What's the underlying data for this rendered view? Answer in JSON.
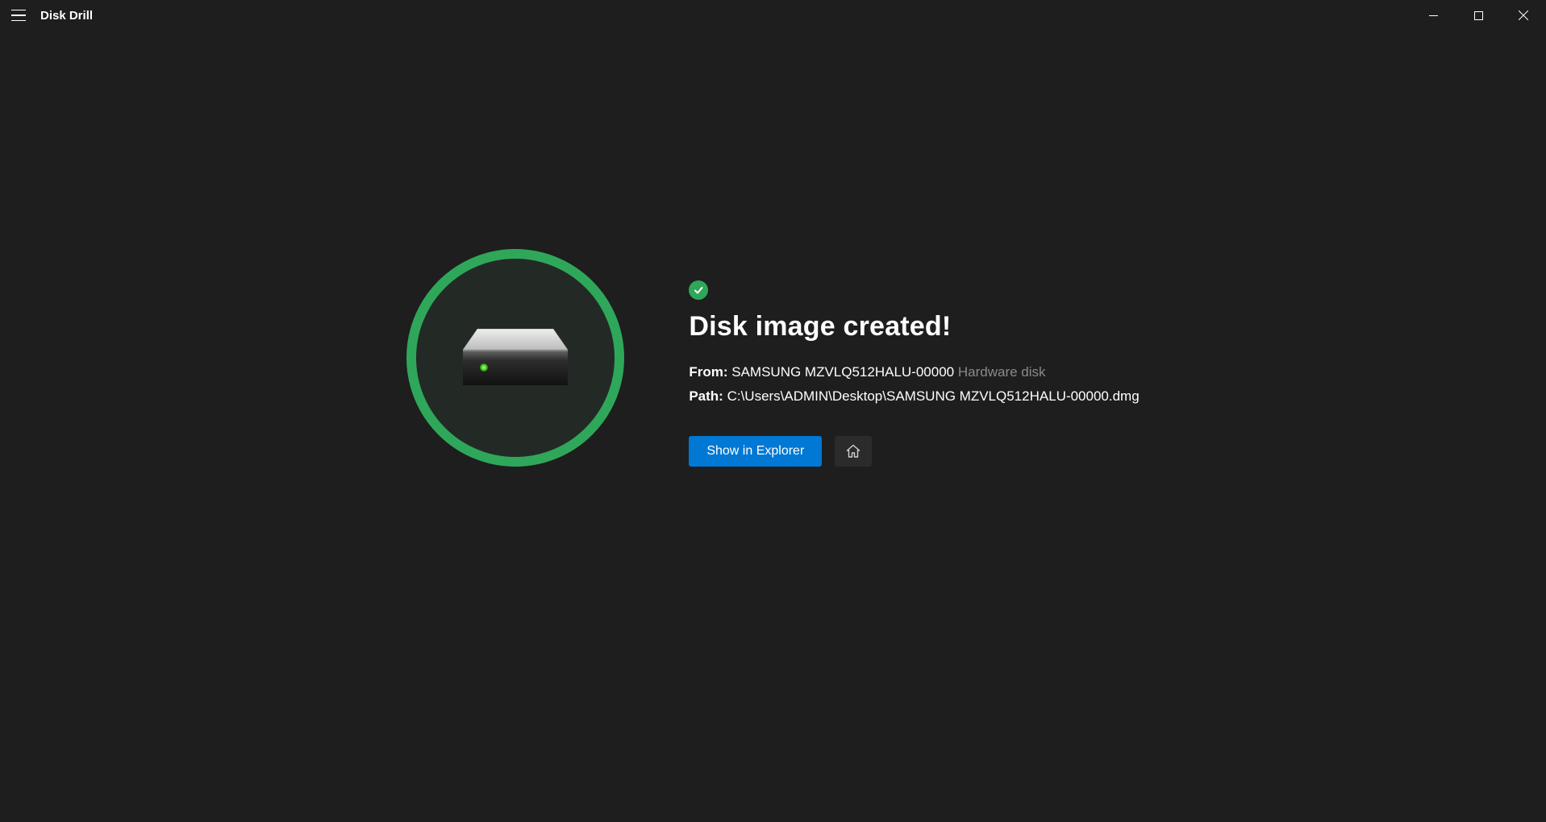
{
  "app": {
    "title": "Disk Drill"
  },
  "result": {
    "heading": "Disk image created!",
    "from_label": "From:",
    "from_value": "SAMSUNG MZVLQ512HALU-00000",
    "from_type": "Hardware disk",
    "path_label": "Path:",
    "path_value": "C:\\Users\\ADMIN\\Desktop\\SAMSUNG MZVLQ512HALU-00000.dmg"
  },
  "actions": {
    "show_in_explorer": "Show in Explorer"
  },
  "colors": {
    "accent_green": "#2fa75a",
    "accent_blue": "#0078d4",
    "bg": "#1e1e1e"
  },
  "icons": {
    "hamburger": "hamburger-icon",
    "minimize": "minimize-icon",
    "maximize": "maximize-icon",
    "close": "close-icon",
    "check": "check-icon",
    "drive": "hard-drive-icon",
    "home": "home-icon"
  }
}
